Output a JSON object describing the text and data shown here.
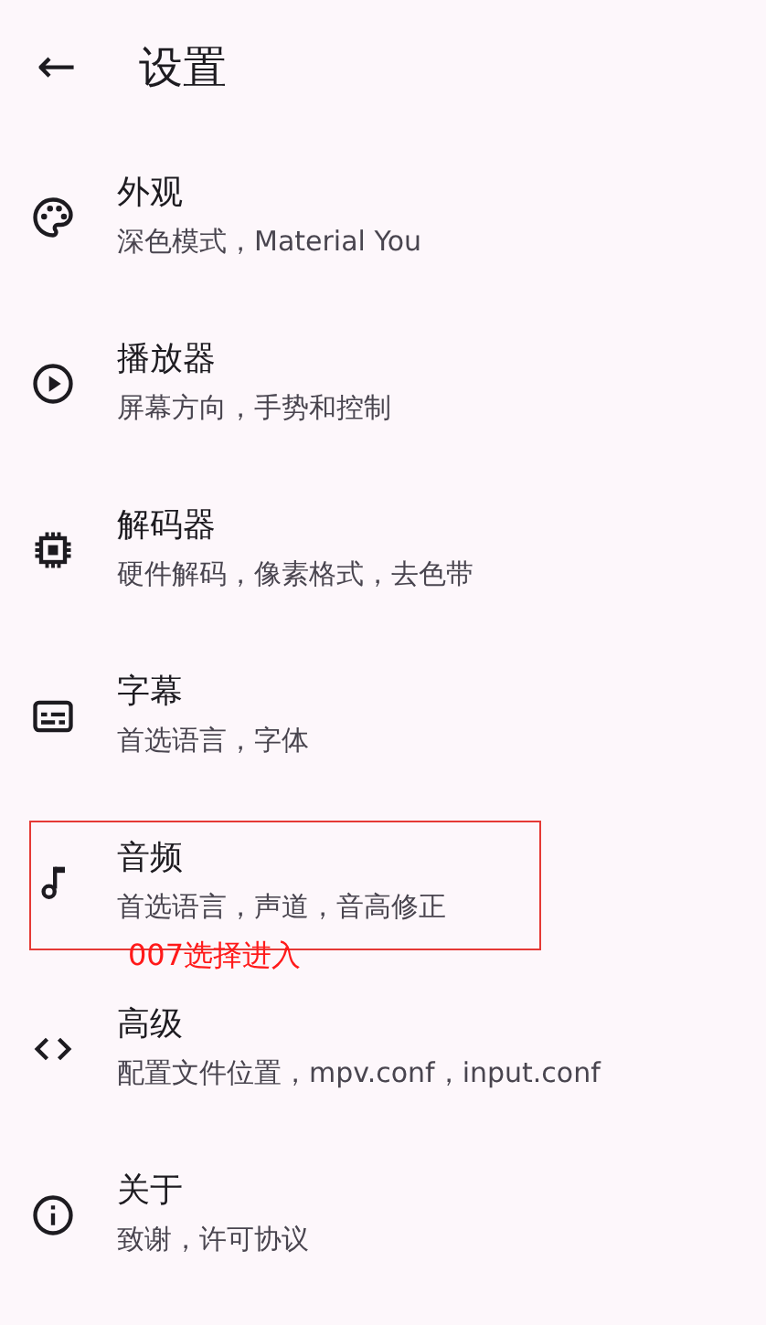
{
  "header": {
    "back": "←",
    "title": "设置"
  },
  "items": [
    {
      "kind": "palette",
      "title": "外观",
      "subtitle": "深色模式，Material You"
    },
    {
      "kind": "play",
      "title": "播放器",
      "subtitle": "屏幕方向，手势和控制"
    },
    {
      "kind": "chip",
      "title": "解码器",
      "subtitle": "硬件解码，像素格式，去色带"
    },
    {
      "kind": "subtitles",
      "title": "字幕",
      "subtitle": "首选语言，字体"
    },
    {
      "kind": "music",
      "title": "音频",
      "subtitle": "首选语言，声道，音高修正",
      "annotation": "007选择进入"
    },
    {
      "kind": "code",
      "title": "高级",
      "subtitle": "配置文件位置，mpv.conf，input.conf"
    },
    {
      "kind": "info",
      "title": "关于",
      "subtitle": "致谢，许可协议"
    }
  ]
}
